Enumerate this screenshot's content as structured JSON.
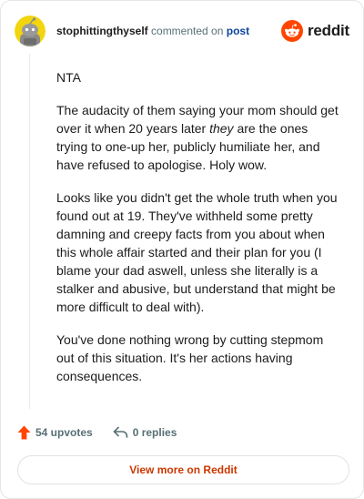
{
  "header": {
    "username": "stophittingthyself",
    "action_text": "commented on",
    "link_text": "post",
    "brand": "reddit"
  },
  "icons": {
    "avatar": "snoo-avatar",
    "brand": "reddit-logo-icon",
    "upvote": "upvote-arrow-icon",
    "reply": "reply-arrow-icon"
  },
  "comment": {
    "paragraphs": [
      "NTA",
      "The audacity of them saying your mom should get over it when 20 years later ",
      "they",
      " are the ones trying to one-up her, publicly humiliate her, and have refused to apologise. Holy wow.",
      "Looks like you didn't get the whole truth when you found out at 19. They've withheld some pretty damning and creepy facts from you about when this whole affair started and their plan for you (I blame your dad aswell, unless she literally is a stalker and abusive, but understand that might be more difficult to deal with).",
      "You've done nothing wrong by cutting stepmom out of this situation. It's her actions having consequences."
    ]
  },
  "footer": {
    "upvotes": "54 upvotes",
    "replies": "0 replies"
  },
  "view_more_label": "View more on Reddit",
  "colors": {
    "accent": "#ff4500",
    "link": "#0a449b",
    "muted": "#576f76",
    "avatar_bg": "#f2d50f"
  }
}
